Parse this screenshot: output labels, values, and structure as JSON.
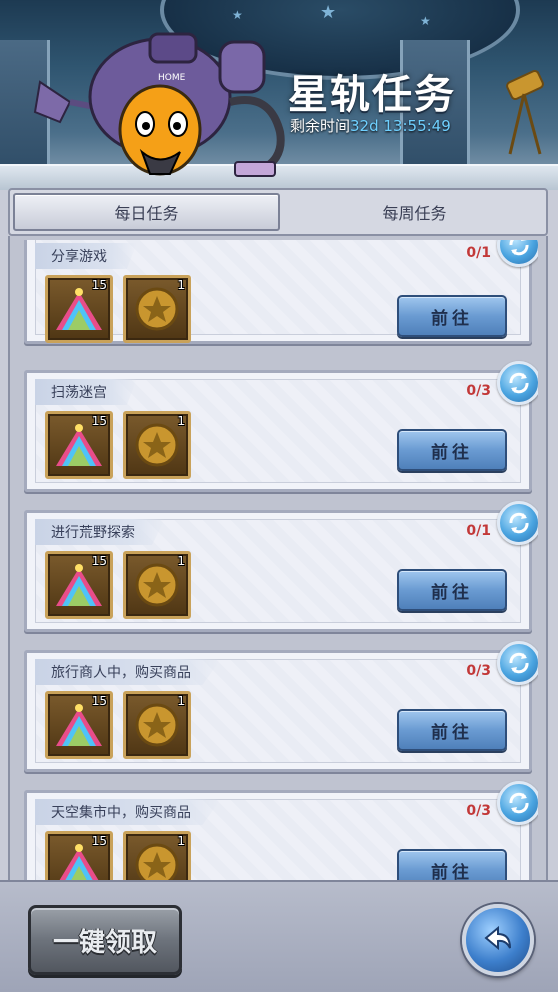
{
  "header": {
    "title": "星轨任务",
    "timer_label": "剩余时间",
    "timer_value": "32d 13:55:49"
  },
  "tabs": [
    {
      "label": "每日任务",
      "active": true
    },
    {
      "label": "每周任务",
      "active": false
    }
  ],
  "tasks": [
    {
      "name": "分享游戏",
      "progress": "0/1",
      "button": "前往",
      "rewards": [
        {
          "icon": "rainbow-gem-pile-icon",
          "count": "15"
        },
        {
          "icon": "gold-star-coin-icon",
          "count": "1"
        }
      ]
    },
    {
      "name": "扫荡迷宫",
      "progress": "0/3",
      "button": "前往",
      "rewards": [
        {
          "icon": "rainbow-gem-pile-icon",
          "count": "15"
        },
        {
          "icon": "gold-star-coin-icon",
          "count": "1"
        }
      ]
    },
    {
      "name": "进行荒野探索",
      "progress": "0/1",
      "button": "前往",
      "rewards": [
        {
          "icon": "rainbow-gem-pile-icon",
          "count": "15"
        },
        {
          "icon": "gold-star-coin-icon",
          "count": "1"
        }
      ]
    },
    {
      "name": "旅行商人中，购买商品",
      "progress": "0/3",
      "button": "前往",
      "rewards": [
        {
          "icon": "rainbow-gem-pile-icon",
          "count": "15"
        },
        {
          "icon": "gold-star-coin-icon",
          "count": "1"
        }
      ]
    },
    {
      "name": "天空集市中，购买商品",
      "progress": "0/3",
      "button": "前往",
      "rewards": [
        {
          "icon": "rainbow-gem-pile-icon",
          "count": "15"
        },
        {
          "icon": "gold-star-coin-icon",
          "count": "1"
        }
      ]
    }
  ],
  "footer": {
    "claim_all_label": "一键领取",
    "back_icon": "back-arrow-icon"
  },
  "colors": {
    "progress": "#c23838",
    "timer_value": "#6fd0ff",
    "go_button": "#6a9bd2"
  }
}
